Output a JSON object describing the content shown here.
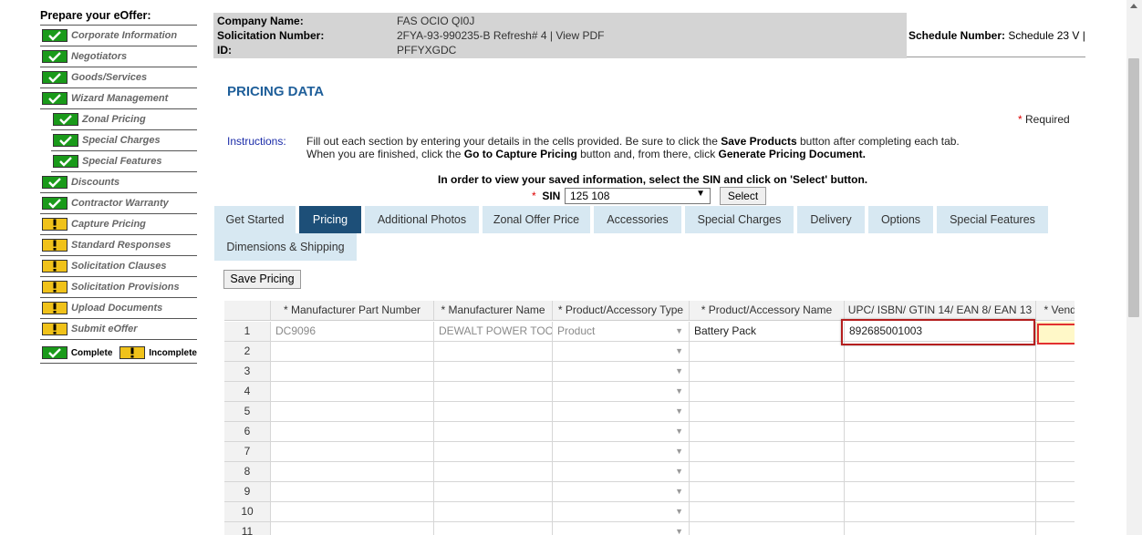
{
  "sidebar": {
    "title": "Prepare your eOffer:",
    "items": [
      {
        "label": "Corporate Information",
        "status": "complete",
        "sub": false
      },
      {
        "label": "Negotiators",
        "status": "complete",
        "sub": false
      },
      {
        "label": "Goods/Services",
        "status": "complete",
        "sub": false
      },
      {
        "label": "Wizard Management",
        "status": "complete",
        "sub": false
      },
      {
        "label": "Zonal Pricing",
        "status": "complete",
        "sub": true
      },
      {
        "label": "Special Charges",
        "status": "complete",
        "sub": true
      },
      {
        "label": "Special Features",
        "status": "complete",
        "sub": true
      },
      {
        "label": "Discounts",
        "status": "complete",
        "sub": false
      },
      {
        "label": "Contractor Warranty",
        "status": "complete",
        "sub": false
      },
      {
        "label": "Capture Pricing",
        "status": "incomplete",
        "sub": false
      },
      {
        "label": "Standard Responses",
        "status": "incomplete",
        "sub": false
      },
      {
        "label": "Solicitation Clauses",
        "status": "incomplete",
        "sub": false
      },
      {
        "label": "Solicitation Provisions",
        "status": "incomplete",
        "sub": false
      },
      {
        "label": "Upload Documents",
        "status": "incomplete",
        "sub": false
      },
      {
        "label": "Submit eOffer",
        "status": "incomplete",
        "sub": false
      }
    ],
    "legend": {
      "complete": "Complete",
      "incomplete": "Incomplete"
    }
  },
  "header": {
    "company_label": "Company Name:",
    "company_value": "FAS OCIO QI0J",
    "solicitation_label": "Solicitation Number:",
    "solicitation_value": "2FYA-93-990235-B Refresh# 4 |",
    "view_pdf": "View PDF",
    "id_label": "ID:",
    "id_value": "PFFYXGDC",
    "schedule_label": "Schedule Number:",
    "schedule_value": "Schedule 23 V |"
  },
  "main": {
    "title": "PRICING DATA",
    "required": "Required",
    "instructions_label": "Instructions:",
    "instr_1a": "Fill out each section by entering your details in the cells provided. Be sure to click the",
    "instr_1b": "Save Products",
    "instr_1c": "button after completing each tab.",
    "instr_2a": "When you are finished, click the",
    "instr_2b": "Go to Capture Pricing",
    "instr_2c": "button and, from there, click",
    "instr_2d": "Generate Pricing Document.",
    "sin_prompt": "In order to view your saved information, select the SIN and click on 'Select' button.",
    "sin_label": "SIN",
    "sin_value": "125 108",
    "select_button": "Select",
    "save_pricing": "Save Pricing"
  },
  "tabs": [
    "Get Started",
    "Pricing",
    "Additional Photos",
    "Zonal Offer Price",
    "Accessories",
    "Special Charges",
    "Delivery",
    "Options",
    "Special Features",
    "Dimensions & Shipping"
  ],
  "active_tab": "Pricing",
  "grid": {
    "columns": [
      "* Manufacturer Part Number",
      "* Manufacturer Name",
      "* Product/Accessory Type",
      "* Product/Accessory Name",
      "UPC/ ISBN/ GTIN 14/ EAN 8/ EAN 13",
      "* Vendo"
    ],
    "rows": [
      {
        "num": "1",
        "part": "DC9096",
        "mfr": "DEWALT POWER TOO",
        "type": "Product",
        "name": "Battery Pack",
        "upc": "892685001003",
        "vendor": ""
      },
      {
        "num": "2",
        "part": "",
        "mfr": "",
        "type": "",
        "name": "",
        "upc": "",
        "vendor": ""
      },
      {
        "num": "3",
        "part": "",
        "mfr": "",
        "type": "",
        "name": "",
        "upc": "",
        "vendor": ""
      },
      {
        "num": "4",
        "part": "",
        "mfr": "",
        "type": "",
        "name": "",
        "upc": "",
        "vendor": ""
      },
      {
        "num": "5",
        "part": "",
        "mfr": "",
        "type": "",
        "name": "",
        "upc": "",
        "vendor": ""
      },
      {
        "num": "6",
        "part": "",
        "mfr": "",
        "type": "",
        "name": "",
        "upc": "",
        "vendor": ""
      },
      {
        "num": "7",
        "part": "",
        "mfr": "",
        "type": "",
        "name": "",
        "upc": "",
        "vendor": ""
      },
      {
        "num": "8",
        "part": "",
        "mfr": "",
        "type": "",
        "name": "",
        "upc": "",
        "vendor": ""
      },
      {
        "num": "9",
        "part": "",
        "mfr": "",
        "type": "",
        "name": "",
        "upc": "",
        "vendor": ""
      },
      {
        "num": "10",
        "part": "",
        "mfr": "",
        "type": "",
        "name": "",
        "upc": "",
        "vendor": ""
      },
      {
        "num": "11",
        "part": "",
        "mfr": "",
        "type": "",
        "name": "",
        "upc": "",
        "vendor": ""
      }
    ]
  },
  "colors": {
    "complete": "#1a9a1a",
    "incomplete": "#f0c21a",
    "active_tab": "#1d4f78",
    "tab": "#d7e8f2",
    "title": "#1f5f9a",
    "highlight_outline": "#b41e1e"
  }
}
